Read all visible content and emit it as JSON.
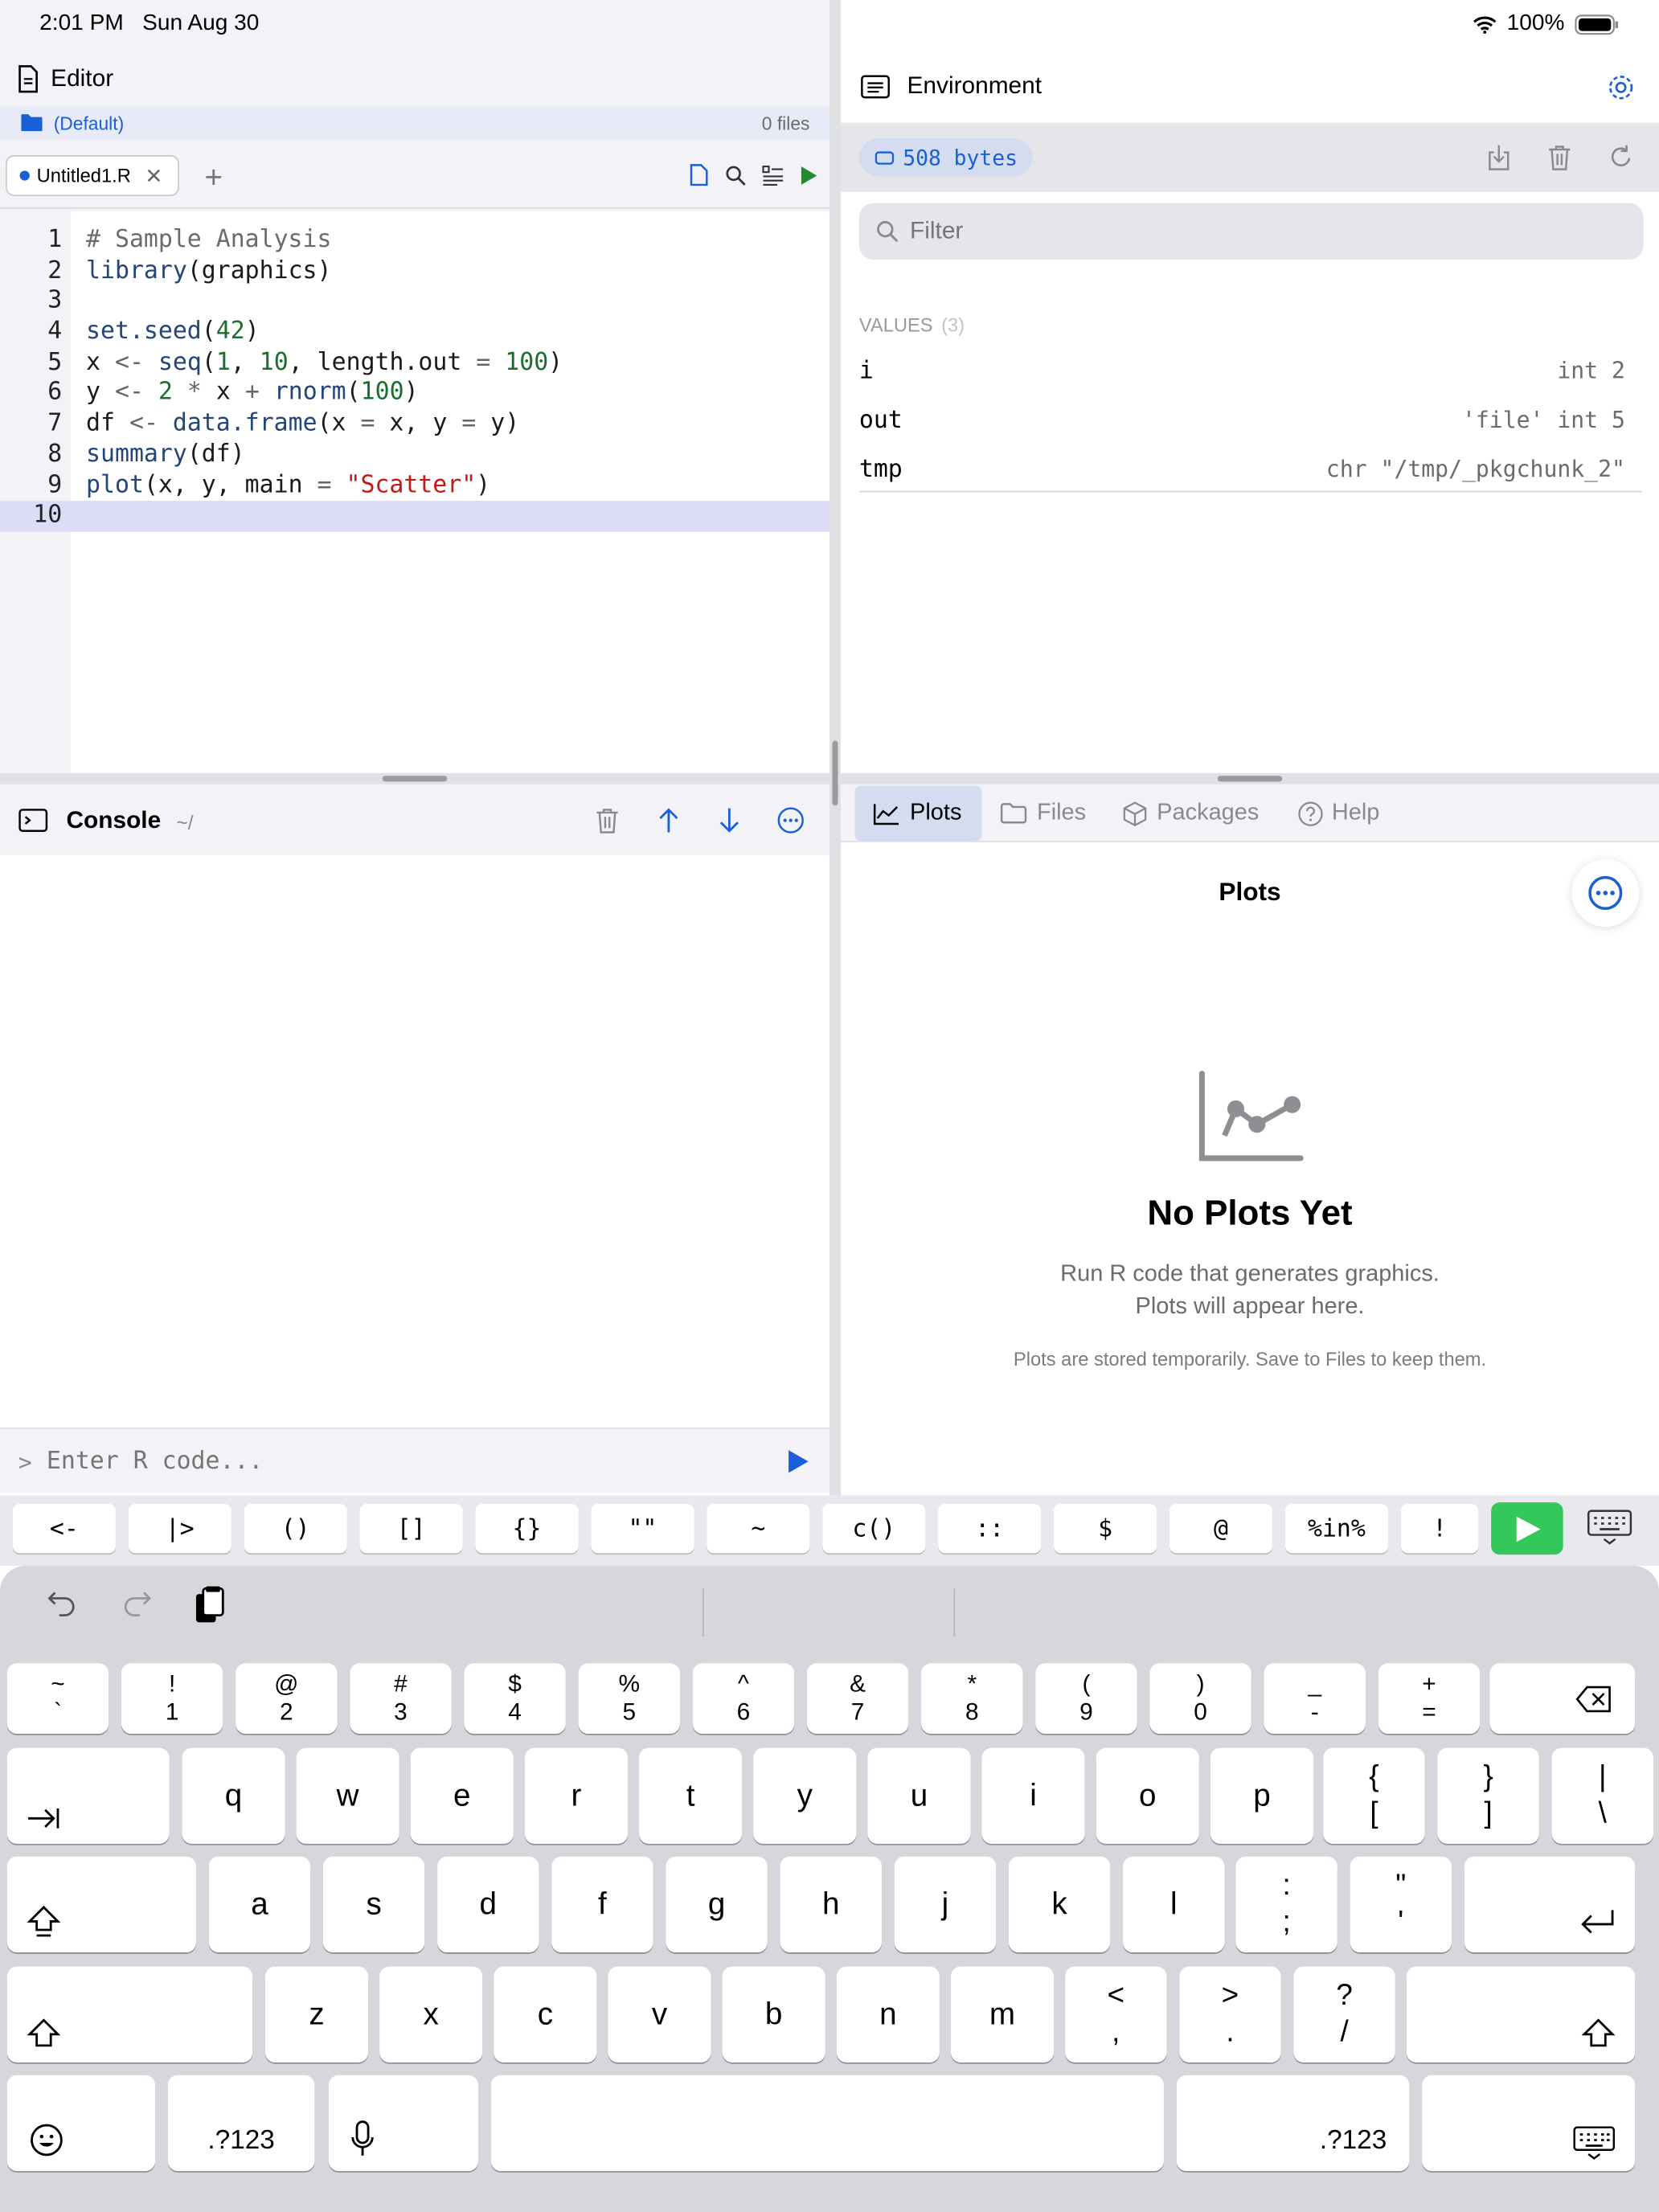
{
  "status_bar": {
    "time": "2:01 PM",
    "date": "Sun Aug 30",
    "battery": "100%"
  },
  "editor": {
    "title": "Editor",
    "project": "(Default)",
    "file_count": "0 files",
    "tab_label": "Untitled1.R",
    "line_numbers": [
      "1",
      "2",
      "3",
      "4",
      "5",
      "6",
      "7",
      "8",
      "9",
      "10"
    ],
    "code_lines": [
      "# Sample Analysis",
      "library(graphics)",
      "",
      "set.seed(42)",
      "x <- seq(1, 10, length.out = 100)",
      "y <- 2 * x + rnorm(100)",
      "df <- data.frame(x = x, y = y)",
      "summary(df)",
      "plot(x, y, main = \"Scatter\")",
      ""
    ]
  },
  "console": {
    "title": "Console",
    "path": "~/",
    "prompt": ">",
    "placeholder": "Enter R code..."
  },
  "environment": {
    "title": "Environment",
    "memory": "508 bytes",
    "filter_placeholder": "Filter",
    "section_label": "VALUES",
    "section_count": "(3)",
    "variables": [
      {
        "name": "i",
        "value": "int 2"
      },
      {
        "name": "out",
        "value": "'file' int 5"
      },
      {
        "name": "tmp",
        "value": "chr \"/tmp/_pkgchunk_2\""
      }
    ]
  },
  "plots_pane": {
    "tabs": [
      "Plots",
      "Files",
      "Packages",
      "Help"
    ],
    "active_tab": "Plots",
    "heading": "Plots",
    "empty_title": "No Plots Yet",
    "empty_line1": "Run R code that generates graphics.",
    "empty_line2": "Plots will appear here.",
    "note": "Plots are stored temporarily. Save to Files to keep them."
  },
  "accessory_keys": [
    "<-",
    "|>",
    "()",
    "[]",
    "{}",
    "\"\"",
    "~",
    "c()",
    "::",
    "$",
    "@",
    "%in%",
    "!"
  ],
  "keyboard": {
    "row1": [
      [
        "~",
        "`"
      ],
      [
        "!",
        "1"
      ],
      [
        "@",
        "2"
      ],
      [
        "#",
        "3"
      ],
      [
        "$",
        "4"
      ],
      [
        "%",
        "5"
      ],
      [
        "^",
        "6"
      ],
      [
        "&",
        "7"
      ],
      [
        "*",
        "8"
      ],
      [
        "(",
        "9"
      ],
      [
        ")",
        "0"
      ],
      [
        "_",
        "-"
      ],
      [
        "+",
        "="
      ]
    ],
    "row2": [
      "q",
      "w",
      "e",
      "r",
      "t",
      "y",
      "u",
      "i",
      "o",
      "p"
    ],
    "row2_extra": [
      [
        "{",
        "["
      ],
      [
        "}",
        "]"
      ],
      [
        "|",
        "\\"
      ]
    ],
    "row3": [
      "a",
      "s",
      "d",
      "f",
      "g",
      "h",
      "j",
      "k",
      "l"
    ],
    "row3_extra": [
      [
        ":",
        ";"
      ],
      [
        "\"",
        "'"
      ]
    ],
    "row4": [
      "z",
      "x",
      "c",
      "v",
      "b",
      "n",
      "m"
    ],
    "row4_extra": [
      [
        "<",
        ","
      ],
      [
        ">",
        "."
      ],
      [
        "?",
        "/"
      ]
    ],
    "numbers_label": ".?123"
  },
  "colors": {
    "accent": "#1b5fd6",
    "run_green": "#34c759",
    "selection": "#dcdcf6"
  }
}
